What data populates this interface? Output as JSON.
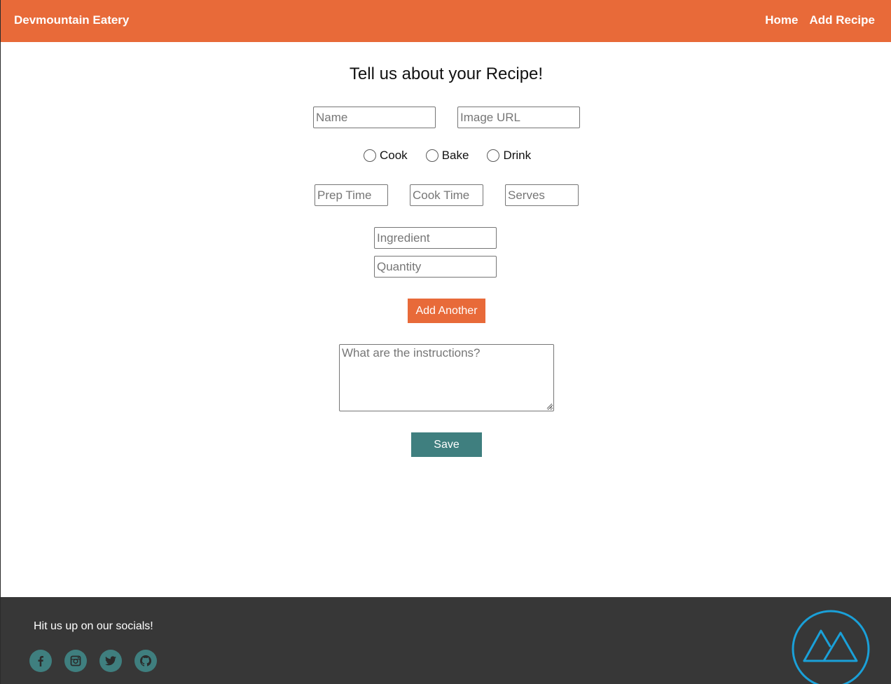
{
  "header": {
    "brand": "Devmountain Eatery",
    "nav": [
      {
        "label": "Home"
      },
      {
        "label": "Add Recipe"
      }
    ]
  },
  "form": {
    "title": "Tell us about your Recipe!",
    "name_placeholder": "Name",
    "image_url_placeholder": "Image URL",
    "types": [
      {
        "label": "Cook"
      },
      {
        "label": "Bake"
      },
      {
        "label": "Drink"
      }
    ],
    "prep_time_placeholder": "Prep Time",
    "cook_time_placeholder": "Cook Time",
    "serves_placeholder": "Serves",
    "ingredient_placeholder": "Ingredient",
    "quantity_placeholder": "Quantity",
    "add_another_label": "Add Another",
    "instructions_placeholder": "What are the instructions?",
    "save_label": "Save"
  },
  "footer": {
    "text": "Hit us up on our socials!",
    "socials": [
      "facebook-icon",
      "instagram-icon",
      "twitter-icon",
      "github-icon"
    ],
    "logo": "devmountain-logo"
  },
  "colors": {
    "header": "#e86a39",
    "accent_button": "#e86a39",
    "save_button": "#3f7f7f",
    "footer": "#373737",
    "social_icon_bg": "#3f7f7f",
    "logo": "#1aa0d8"
  }
}
